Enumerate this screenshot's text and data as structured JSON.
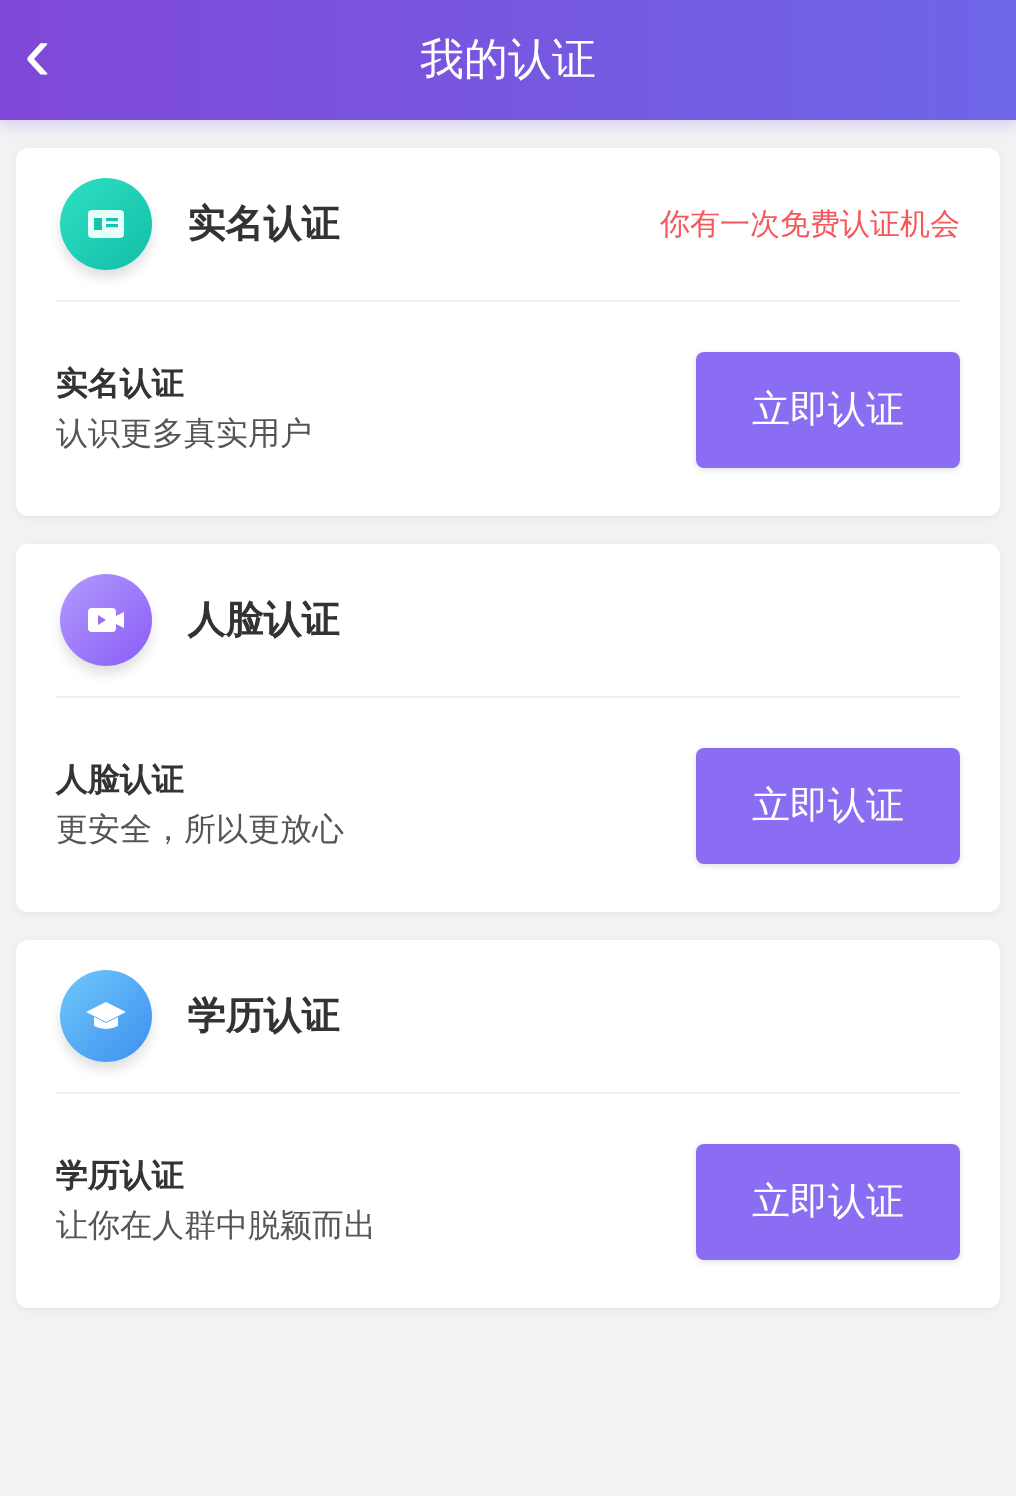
{
  "header": {
    "back_icon": "‹",
    "title": "我的认证"
  },
  "cards": [
    {
      "kind": "id-card",
      "title": "实名认证",
      "note": "你有一次免费认证机会",
      "subtitle": "实名认证",
      "description": "认识更多真实用户",
      "button": "立即认证"
    },
    {
      "kind": "video",
      "title": "人脸认证",
      "subtitle": "人脸认证",
      "description": "更安全，所以更放心",
      "button": "立即认证"
    },
    {
      "kind": "graduation",
      "title": "学历认证",
      "subtitle": "学历认证",
      "description": "让你在人群中脱颖而出",
      "button": "立即认证"
    }
  ]
}
